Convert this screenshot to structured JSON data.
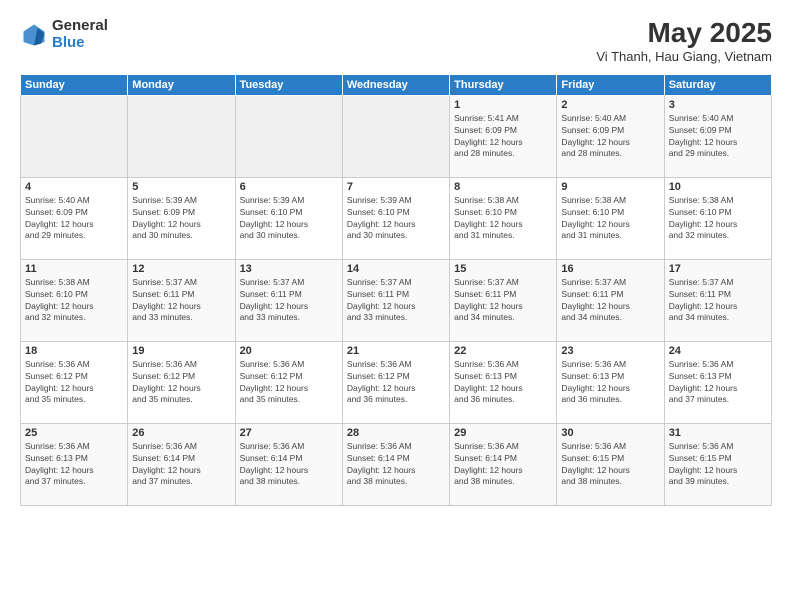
{
  "logo": {
    "general": "General",
    "blue": "Blue"
  },
  "title": "May 2025",
  "subtitle": "Vi Thanh, Hau Giang, Vietnam",
  "weekdays": [
    "Sunday",
    "Monday",
    "Tuesday",
    "Wednesday",
    "Thursday",
    "Friday",
    "Saturday"
  ],
  "weeks": [
    [
      {
        "day": "",
        "empty": true
      },
      {
        "day": "",
        "empty": true
      },
      {
        "day": "",
        "empty": true
      },
      {
        "day": "",
        "empty": true
      },
      {
        "day": "1",
        "sunrise": "5:41 AM",
        "sunset": "6:09 PM",
        "daylight": "12 hours and 28 minutes."
      },
      {
        "day": "2",
        "sunrise": "5:40 AM",
        "sunset": "6:09 PM",
        "daylight": "12 hours and 28 minutes."
      },
      {
        "day": "3",
        "sunrise": "5:40 AM",
        "sunset": "6:09 PM",
        "daylight": "12 hours and 29 minutes."
      }
    ],
    [
      {
        "day": "4",
        "sunrise": "5:40 AM",
        "sunset": "6:09 PM",
        "daylight": "12 hours and 29 minutes."
      },
      {
        "day": "5",
        "sunrise": "5:39 AM",
        "sunset": "6:09 PM",
        "daylight": "12 hours and 30 minutes."
      },
      {
        "day": "6",
        "sunrise": "5:39 AM",
        "sunset": "6:10 PM",
        "daylight": "12 hours and 30 minutes."
      },
      {
        "day": "7",
        "sunrise": "5:39 AM",
        "sunset": "6:10 PM",
        "daylight": "12 hours and 30 minutes."
      },
      {
        "day": "8",
        "sunrise": "5:38 AM",
        "sunset": "6:10 PM",
        "daylight": "12 hours and 31 minutes."
      },
      {
        "day": "9",
        "sunrise": "5:38 AM",
        "sunset": "6:10 PM",
        "daylight": "12 hours and 31 minutes."
      },
      {
        "day": "10",
        "sunrise": "5:38 AM",
        "sunset": "6:10 PM",
        "daylight": "12 hours and 32 minutes."
      }
    ],
    [
      {
        "day": "11",
        "sunrise": "5:38 AM",
        "sunset": "6:10 PM",
        "daylight": "12 hours and 32 minutes."
      },
      {
        "day": "12",
        "sunrise": "5:37 AM",
        "sunset": "6:11 PM",
        "daylight": "12 hours and 33 minutes."
      },
      {
        "day": "13",
        "sunrise": "5:37 AM",
        "sunset": "6:11 PM",
        "daylight": "12 hours and 33 minutes."
      },
      {
        "day": "14",
        "sunrise": "5:37 AM",
        "sunset": "6:11 PM",
        "daylight": "12 hours and 33 minutes."
      },
      {
        "day": "15",
        "sunrise": "5:37 AM",
        "sunset": "6:11 PM",
        "daylight": "12 hours and 34 minutes."
      },
      {
        "day": "16",
        "sunrise": "5:37 AM",
        "sunset": "6:11 PM",
        "daylight": "12 hours and 34 minutes."
      },
      {
        "day": "17",
        "sunrise": "5:37 AM",
        "sunset": "6:11 PM",
        "daylight": "12 hours and 34 minutes."
      }
    ],
    [
      {
        "day": "18",
        "sunrise": "5:36 AM",
        "sunset": "6:12 PM",
        "daylight": "12 hours and 35 minutes."
      },
      {
        "day": "19",
        "sunrise": "5:36 AM",
        "sunset": "6:12 PM",
        "daylight": "12 hours and 35 minutes."
      },
      {
        "day": "20",
        "sunrise": "5:36 AM",
        "sunset": "6:12 PM",
        "daylight": "12 hours and 35 minutes."
      },
      {
        "day": "21",
        "sunrise": "5:36 AM",
        "sunset": "6:12 PM",
        "daylight": "12 hours and 36 minutes."
      },
      {
        "day": "22",
        "sunrise": "5:36 AM",
        "sunset": "6:13 PM",
        "daylight": "12 hours and 36 minutes."
      },
      {
        "day": "23",
        "sunrise": "5:36 AM",
        "sunset": "6:13 PM",
        "daylight": "12 hours and 36 minutes."
      },
      {
        "day": "24",
        "sunrise": "5:36 AM",
        "sunset": "6:13 PM",
        "daylight": "12 hours and 37 minutes."
      }
    ],
    [
      {
        "day": "25",
        "sunrise": "5:36 AM",
        "sunset": "6:13 PM",
        "daylight": "12 hours and 37 minutes."
      },
      {
        "day": "26",
        "sunrise": "5:36 AM",
        "sunset": "6:14 PM",
        "daylight": "12 hours and 37 minutes."
      },
      {
        "day": "27",
        "sunrise": "5:36 AM",
        "sunset": "6:14 PM",
        "daylight": "12 hours and 38 minutes."
      },
      {
        "day": "28",
        "sunrise": "5:36 AM",
        "sunset": "6:14 PM",
        "daylight": "12 hours and 38 minutes."
      },
      {
        "day": "29",
        "sunrise": "5:36 AM",
        "sunset": "6:14 PM",
        "daylight": "12 hours and 38 minutes."
      },
      {
        "day": "30",
        "sunrise": "5:36 AM",
        "sunset": "6:15 PM",
        "daylight": "12 hours and 38 minutes."
      },
      {
        "day": "31",
        "sunrise": "5:36 AM",
        "sunset": "6:15 PM",
        "daylight": "12 hours and 39 minutes."
      }
    ]
  ]
}
